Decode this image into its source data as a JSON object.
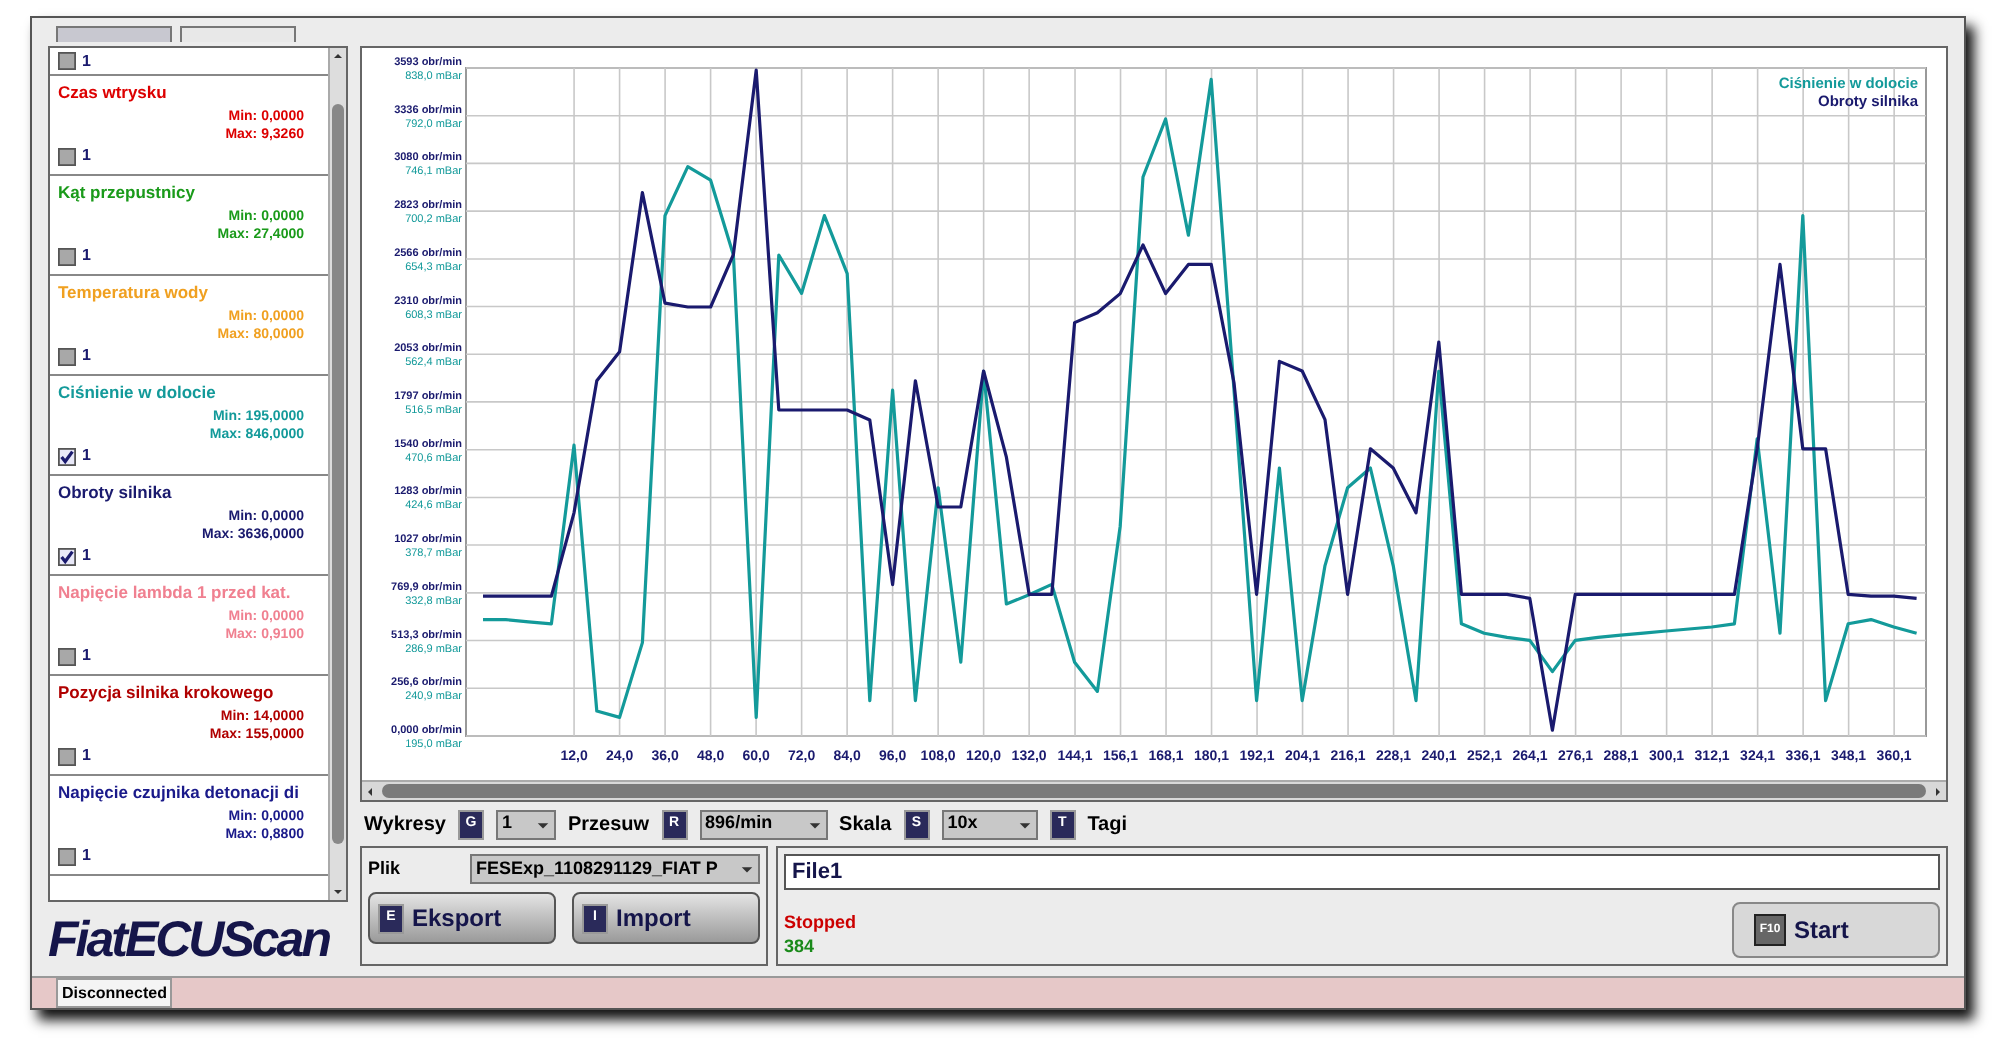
{
  "sidebar": {
    "top_partial": {
      "checked": false,
      "count": "1"
    },
    "items": [
      {
        "name": "Czas wtrysku",
        "color": "#dd0000",
        "min": "Min: 0,0000",
        "max": "Max: 9,3260",
        "checked": false,
        "count": "1"
      },
      {
        "name": "Kąt przepustnicy",
        "color": "#1a9a1a",
        "min": "Min: 0,0000",
        "max": "Max: 27,4000",
        "checked": false,
        "count": "1"
      },
      {
        "name": "Temperatura wody",
        "color": "#f0a020",
        "min": "Min: 0,0000",
        "max": "Max: 80,0000",
        "checked": false,
        "count": "1"
      },
      {
        "name": "Ciśnienie w dolocie",
        "color": "#139a9a",
        "min": "Min: 195,0000",
        "max": "Max: 846,0000",
        "checked": true,
        "count": "1"
      },
      {
        "name": "Obroty silnika",
        "color": "#1a1a6e",
        "min": "Min: 0,0000",
        "max": "Max: 3636,0000",
        "checked": true,
        "count": "1"
      },
      {
        "name": "Napięcie lambda 1 przed kat.",
        "color": "#f08090",
        "min": "Min: 0,0000",
        "max": "Max: 0,9100",
        "checked": false,
        "count": "1"
      },
      {
        "name": "Pozycja silnika krokowego",
        "color": "#b00000",
        "min": "Min: 14,0000",
        "max": "Max: 155,0000",
        "checked": false,
        "count": "1"
      },
      {
        "name": "Napięcie czujnika detonacji di",
        "color": "#1a1a8a",
        "min": "Min: 0,0000",
        "max": "Max: 0,8800",
        "checked": false,
        "count": "1"
      }
    ]
  },
  "logo": "FiatECUScan",
  "chart": {
    "chart_data": {
      "type": "line",
      "grid": true,
      "x": [
        -12,
        -6,
        0,
        6,
        12,
        18,
        24,
        30,
        36,
        42,
        48,
        54,
        60,
        66,
        72,
        78,
        84,
        90,
        96,
        102,
        108,
        114,
        120,
        126,
        132,
        138,
        144,
        150,
        156,
        162,
        168,
        174,
        180,
        186,
        192,
        198,
        204,
        210,
        216,
        222,
        228,
        234,
        240,
        246,
        252,
        258,
        264,
        270,
        276,
        282,
        288,
        294,
        300,
        306,
        312,
        318,
        324,
        330,
        336,
        342,
        348,
        354,
        360,
        366
      ],
      "xlim": [
        -16.5,
        368.5
      ],
      "xticks": [
        {
          "value": 12,
          "label": "12,0"
        },
        {
          "value": 24,
          "label": "24,0"
        },
        {
          "value": 36,
          "label": "36,0"
        },
        {
          "value": 48,
          "label": "48,0"
        },
        {
          "value": 60,
          "label": "60,0"
        },
        {
          "value": 72,
          "label": "72,0"
        },
        {
          "value": 84,
          "label": "84,0"
        },
        {
          "value": 96,
          "label": "96,0"
        },
        {
          "value": 108,
          "label": "108,0"
        },
        {
          "value": 120,
          "label": "120,0"
        },
        {
          "value": 132,
          "label": "132,0"
        },
        {
          "value": 144.1,
          "label": "144,1"
        },
        {
          "value": 156.1,
          "label": "156,1"
        },
        {
          "value": 168.1,
          "label": "168,1"
        },
        {
          "value": 180.1,
          "label": "180,1"
        },
        {
          "value": 192.1,
          "label": "192,1"
        },
        {
          "value": 204.1,
          "label": "204,1"
        },
        {
          "value": 216.1,
          "label": "216,1"
        },
        {
          "value": 228.1,
          "label": "228,1"
        },
        {
          "value": 240.1,
          "label": "240,1"
        },
        {
          "value": 252.1,
          "label": "252,1"
        },
        {
          "value": 264.1,
          "label": "264,1"
        },
        {
          "value": 276.1,
          "label": "276,1"
        },
        {
          "value": 288.1,
          "label": "288,1"
        },
        {
          "value": 300.1,
          "label": "300,1"
        },
        {
          "value": 312.1,
          "label": "312,1"
        },
        {
          "value": 324.1,
          "label": "324,1"
        },
        {
          "value": 336.1,
          "label": "336,1"
        },
        {
          "value": 348.1,
          "label": "348,1"
        },
        {
          "value": 360.1,
          "label": "360,1"
        }
      ],
      "ylim": [
        0,
        3593
      ],
      "yticks": [
        {
          "value": 0,
          "label": "0,000 obr/min"
        },
        {
          "value": 256.6,
          "label": "256,6 obr/min"
        },
        {
          "value": 513.3,
          "label": "513,3 obr/min"
        },
        {
          "value": 769.9,
          "label": "769,9 obr/min"
        },
        {
          "value": 1027,
          "label": "1027 obr/min"
        },
        {
          "value": 1283,
          "label": "1283 obr/min"
        },
        {
          "value": 1540,
          "label": "1540 obr/min"
        },
        {
          "value": 1797,
          "label": "1797 obr/min"
        },
        {
          "value": 2053,
          "label": "2053 obr/min"
        },
        {
          "value": 2310,
          "label": "2310 obr/min"
        },
        {
          "value": 2566,
          "label": "2566 obr/min"
        },
        {
          "value": 2823,
          "label": "2823 obr/min"
        },
        {
          "value": 3080,
          "label": "3080 obr/min"
        },
        {
          "value": 3336,
          "label": "3336 obr/min"
        },
        {
          "value": 3593,
          "label": "3593 obr/min"
        }
      ],
      "y2lim": [
        195,
        838
      ],
      "y2ticks": [
        {
          "value": 195,
          "label": "195,0 mBar"
        },
        {
          "value": 240.9,
          "label": "240,9 mBar"
        },
        {
          "value": 286.9,
          "label": "286,9 mBar"
        },
        {
          "value": 332.8,
          "label": "332,8 mBar"
        },
        {
          "value": 378.7,
          "label": "378,7 mBar"
        },
        {
          "value": 424.6,
          "label": "424,6 mBar"
        },
        {
          "value": 470.6,
          "label": "470,6 mBar"
        },
        {
          "value": 516.5,
          "label": "516,5 mBar"
        },
        {
          "value": 562.4,
          "label": "562,4 mBar"
        },
        {
          "value": 608.3,
          "label": "608,3 mBar"
        },
        {
          "value": 654.3,
          "label": "654,3 mBar"
        },
        {
          "value": 700.2,
          "label": "700,2 mBar"
        },
        {
          "value": 746.1,
          "label": "746,1 mBar"
        },
        {
          "value": 792.0,
          "label": "792,0 mBar"
        },
        {
          "value": 838.0,
          "label": "838,0 mBar"
        }
      ],
      "series": [
        {
          "name": "Ciśnienie w dolocie",
          "color": "#139a9a",
          "axis": "y2",
          "values": [
            307,
            307,
            305,
            303,
            475,
            219,
            213,
            285,
            696,
            743,
            730,
            658,
            213,
            658,
            621,
            696,
            640,
            229,
            528,
            229,
            434,
            266,
            546,
            322,
            331,
            341,
            266,
            238,
            397,
            733,
            789,
            677,
            827,
            528,
            229,
            453,
            229,
            359,
            434,
            453,
            359,
            229,
            546,
            303,
            294,
            290,
            287,
            257,
            287,
            290,
            292,
            294,
            296,
            298,
            300,
            303,
            481,
            294,
            696,
            229,
            303,
            307,
            300,
            294
          ]
        },
        {
          "name": "Obroty silnika",
          "color": "#1a1a6e",
          "axis": "y",
          "values": [
            752,
            752,
            752,
            752,
            1200,
            1910,
            2067,
            2923,
            2328,
            2307,
            2307,
            2589,
            3581,
            1754,
            1754,
            1754,
            1754,
            1700,
            814,
            1910,
            1232,
            1232,
            1963,
            1500,
            762,
            762,
            2224,
            2276,
            2380,
            2641,
            2380,
            2537,
            2537,
            1900,
            762,
            2015,
            1963,
            1702,
            762,
            1545,
            1441,
            1200,
            2119,
            762,
            762,
            762,
            740,
            31,
            762,
            762,
            762,
            762,
            762,
            762,
            762,
            762,
            1545,
            2537,
            1545,
            1545,
            762,
            752,
            752,
            740
          ]
        }
      ]
    }
  },
  "toolbar": {
    "charts": {
      "label": "Wykresy",
      "key": "G",
      "value": "1"
    },
    "shift": {
      "label": "Przesuw",
      "key": "R",
      "value": "896/min"
    },
    "scale": {
      "label": "Skala",
      "key": "S",
      "value": "10x"
    },
    "tags": {
      "key": "T",
      "label": "Tagi"
    }
  },
  "file_panel": {
    "label": "Plik",
    "value": "FESExp_1108291129_FIAT P",
    "buttons": [
      {
        "key": "E",
        "label": "Eksport"
      },
      {
        "key": "I",
        "label": "Import"
      }
    ]
  },
  "run_panel": {
    "name": "File1",
    "status": "Stopped",
    "count": "384",
    "start": {
      "key": "F10",
      "label": "Start"
    }
  },
  "status_bar": {
    "connection": "Disconnected"
  }
}
